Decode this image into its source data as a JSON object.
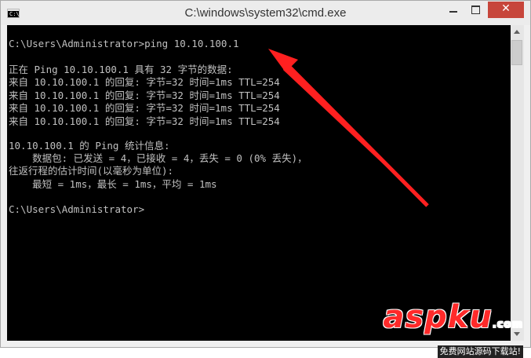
{
  "window": {
    "title": "C:\\windows\\system32\\cmd.exe",
    "icon_glyph": "C:\\",
    "close_glyph": "✕"
  },
  "console": {
    "lines": [
      "C:\\Users\\Administrator>ping 10.10.100.1",
      "",
      "正在 Ping 10.10.100.1 具有 32 字节的数据:",
      "来自 10.10.100.1 的回复: 字节=32 时间=1ms TTL=254",
      "来自 10.10.100.1 的回复: 字节=32 时间=1ms TTL=254",
      "来自 10.10.100.1 的回复: 字节=32 时间=1ms TTL=254",
      "来自 10.10.100.1 的回复: 字节=32 时间=1ms TTL=254",
      "",
      "10.10.100.1 的 Ping 统计信息:",
      "    数据包: 已发送 = 4，已接收 = 4，丢失 = 0 (0% 丢失)，",
      "往返行程的估计时间(以毫秒为单位):",
      "    最短 = 1ms，最长 = 1ms，平均 = 1ms",
      "",
      "C:\\Users\\Administrator>"
    ]
  },
  "watermark": {
    "logo": "aspku",
    "tld": ".com",
    "subtitle": "免费网站源码下载站!"
  },
  "colors": {
    "console_bg": "#000000",
    "console_text": "#c0c0c0",
    "close_button": "#c7463b",
    "annotation_arrow": "#ff2020"
  }
}
